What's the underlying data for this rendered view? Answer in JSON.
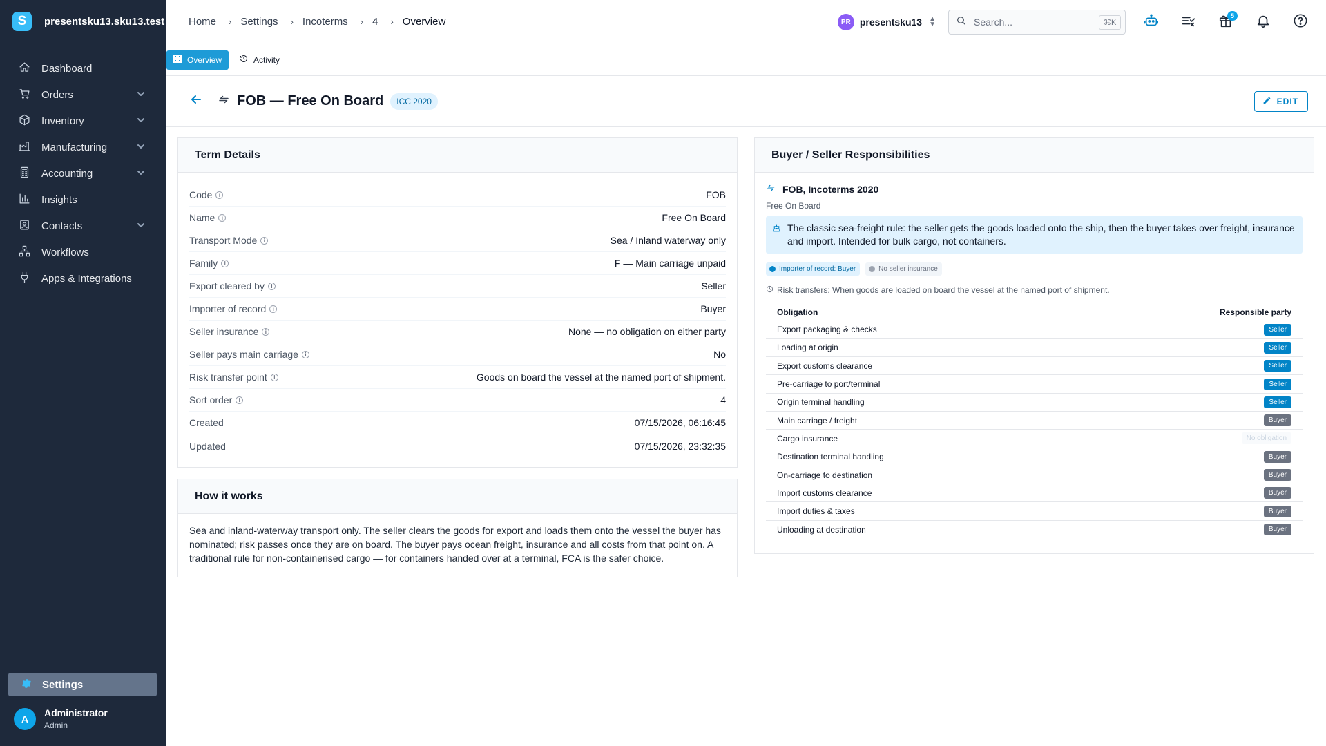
{
  "brand": {
    "logo_letter": "S",
    "name": "presentsku13.sku13.test"
  },
  "sidebar": {
    "items": [
      {
        "label": "Dashboard",
        "icon": "home-icon",
        "expandable": false
      },
      {
        "label": "Orders",
        "icon": "cart-icon",
        "expandable": true
      },
      {
        "label": "Inventory",
        "icon": "box-icon",
        "expandable": true
      },
      {
        "label": "Manufacturing",
        "icon": "factory-icon",
        "expandable": true
      },
      {
        "label": "Accounting",
        "icon": "calculator-icon",
        "expandable": true
      },
      {
        "label": "Insights",
        "icon": "bar-chart-icon",
        "expandable": false
      },
      {
        "label": "Contacts",
        "icon": "contacts-icon",
        "expandable": true
      },
      {
        "label": "Workflows",
        "icon": "workflow-icon",
        "expandable": false
      },
      {
        "label": "Apps & Integrations",
        "icon": "plug-icon",
        "expandable": false
      }
    ],
    "settings_label": "Settings",
    "user": {
      "initial": "A",
      "name": "Administrator",
      "role": "Admin"
    }
  },
  "breadcrumb": [
    "Home",
    "Settings",
    "Incoterms",
    "4",
    "Overview"
  ],
  "topbar": {
    "org_initials": "PR",
    "org_name": "presentsku13",
    "search_placeholder": "Search...",
    "search_shortcut": "⌘K",
    "gift_badge": "5"
  },
  "tabs": [
    {
      "label": "Overview",
      "active": true
    },
    {
      "label": "Activity",
      "active": false
    }
  ],
  "header": {
    "title": "FOB — Free On Board",
    "chip": "ICC 2020",
    "edit_label": "EDIT"
  },
  "term_details": {
    "heading": "Term Details",
    "rows": [
      {
        "label": "Code",
        "value": "FOB",
        "info": true
      },
      {
        "label": "Name",
        "value": "Free On Board",
        "info": true
      },
      {
        "label": "Transport Mode",
        "value": "Sea / Inland waterway only",
        "info": true
      },
      {
        "label": "Family",
        "value": "F — Main carriage unpaid",
        "info": true
      },
      {
        "label": "Export cleared by",
        "value": "Seller",
        "info": true
      },
      {
        "label": "Importer of record",
        "value": "Buyer",
        "info": true
      },
      {
        "label": "Seller insurance",
        "value": "None — no obligation on either party",
        "info": true
      },
      {
        "label": "Seller pays main carriage",
        "value": "No",
        "info": true
      },
      {
        "label": "Risk transfer point",
        "value": "Goods on board the vessel at the named port of shipment.",
        "info": true
      },
      {
        "label": "Sort order",
        "value": "4",
        "info": true
      },
      {
        "label": "Created",
        "value": "07/15/2026, 06:16:45",
        "info": false
      },
      {
        "label": "Updated",
        "value": "07/15/2026, 23:32:35",
        "info": false
      }
    ]
  },
  "how_it_works": {
    "heading": "How it works",
    "text": "Sea and inland-waterway transport only. The seller clears the goods for export and loads them onto the vessel the buyer has nominated; risk passes once they are on board. The buyer pays ocean freight, insurance and all costs from that point on. A traditional rule for non-containerised cargo — for containers handed over at a terminal, FCA is the safer choice."
  },
  "responsibilities": {
    "heading": "Buyer / Seller Responsibilities",
    "title": "FOB, Incoterms 2020",
    "subtitle": "Free On Board",
    "callout": "The classic sea-freight rule: the seller gets the goods loaded onto the ship, then the buyer takes over freight, insurance and import. Intended for bulk cargo, not containers.",
    "chips": [
      {
        "label": "Importer of record: Buyer",
        "tone": "blue"
      },
      {
        "label": "No seller insurance",
        "tone": "gray"
      }
    ],
    "risk_text": "Risk transfers: When goods are loaded on board the vessel at the named port of shipment.",
    "col_obligation": "Obligation",
    "col_party": "Responsible party",
    "rows": [
      {
        "obligation": "Export packaging & checks",
        "party": "Seller"
      },
      {
        "obligation": "Loading at origin",
        "party": "Seller"
      },
      {
        "obligation": "Export customs clearance",
        "party": "Seller"
      },
      {
        "obligation": "Pre-carriage to port/terminal",
        "party": "Seller"
      },
      {
        "obligation": "Origin terminal handling",
        "party": "Seller"
      },
      {
        "obligation": "Main carriage / freight",
        "party": "Buyer"
      },
      {
        "obligation": "Cargo insurance",
        "party": "No obligation"
      },
      {
        "obligation": "Destination terminal handling",
        "party": "Buyer"
      },
      {
        "obligation": "On-carriage to destination",
        "party": "Buyer"
      },
      {
        "obligation": "Import customs clearance",
        "party": "Buyer"
      },
      {
        "obligation": "Import duties & taxes",
        "party": "Buyer"
      },
      {
        "obligation": "Unloading at destination",
        "party": "Buyer"
      }
    ]
  },
  "colors": {
    "sidebar_bg": "#1e293b",
    "accent": "#0284c7",
    "tab_active": "#1d9bd7",
    "seller": "#0284c7",
    "buyer": "#6b7280"
  }
}
